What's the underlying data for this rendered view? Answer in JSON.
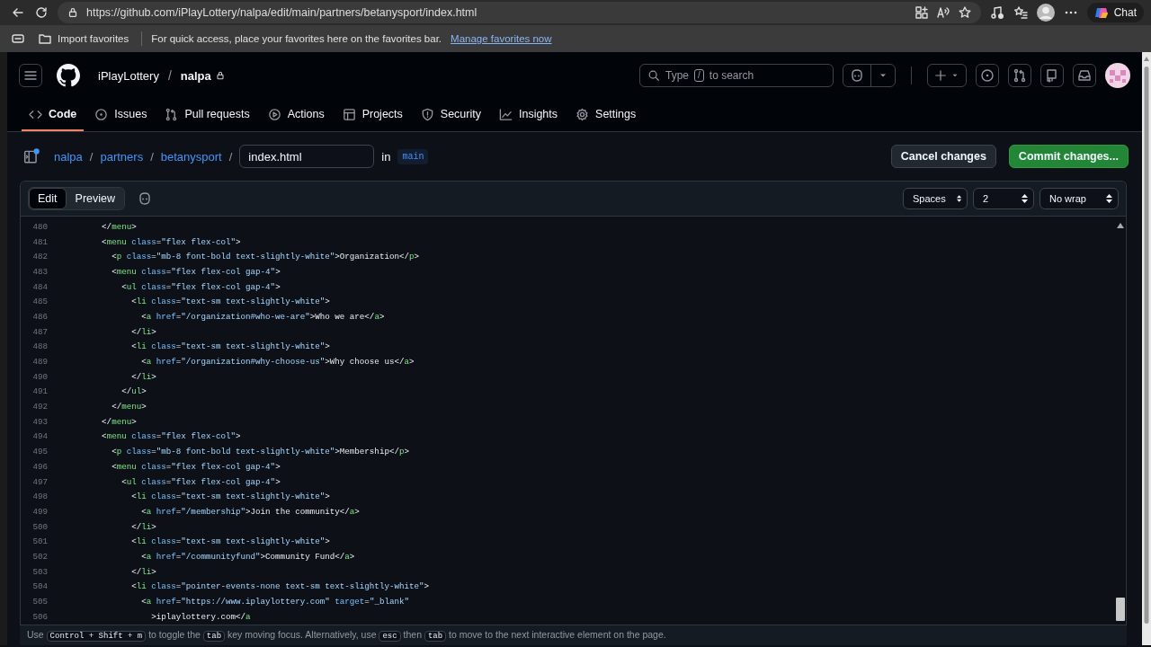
{
  "browser": {
    "url": "https://github.com/iPlayLottery/nalpa/edit/main/partners/betanysport/index.html",
    "import_favorites": "Import favorites",
    "favorites_message": "For quick access, place your favorites here on the favorites bar.",
    "favorites_link": "Manage favorites now",
    "chat": "Chat"
  },
  "header": {
    "owner": "iPlayLottery",
    "separator": "/",
    "repo": "nalpa",
    "search": {
      "before": "Type",
      "key": "/",
      "after": "to search"
    }
  },
  "nav_tabs": [
    {
      "label": "Code",
      "selected": true
    },
    {
      "label": "Issues",
      "selected": false
    },
    {
      "label": "Pull requests",
      "selected": false
    },
    {
      "label": "Actions",
      "selected": false
    },
    {
      "label": "Projects",
      "selected": false
    },
    {
      "label": "Security",
      "selected": false
    },
    {
      "label": "Insights",
      "selected": false
    },
    {
      "label": "Settings",
      "selected": false
    }
  ],
  "file_bar": {
    "breadcrumb": [
      "nalpa",
      "partners",
      "betanysport"
    ],
    "separator": "/",
    "filename": "index.html",
    "in_label": "in",
    "branch": "main",
    "cancel": "Cancel changes",
    "commit": "Commit changes..."
  },
  "editor": {
    "tabs": [
      {
        "label": "Edit",
        "selected": true
      },
      {
        "label": "Preview",
        "selected": false
      }
    ],
    "selects": [
      "Spaces",
      "2",
      "No wrap"
    ],
    "lines": [
      {
        "n": "480",
        "code": "        </menu>"
      },
      {
        "n": "481",
        "code": "        <menu class=\"flex flex-col\">"
      },
      {
        "n": "482",
        "code": "          <p class=\"mb-8 font-bold text-slightly-white\">Organization</p>"
      },
      {
        "n": "483",
        "code": "          <menu class=\"flex flex-col gap-4\">"
      },
      {
        "n": "484",
        "code": "            <ul class=\"flex flex-col gap-4\">"
      },
      {
        "n": "485",
        "code": "              <li class=\"text-sm text-slightly-white\">"
      },
      {
        "n": "486",
        "code": "                <a href=\"/organization#who-we-are\">Who we are</a>"
      },
      {
        "n": "487",
        "code": "              </li>"
      },
      {
        "n": "488",
        "code": "              <li class=\"text-sm text-slightly-white\">"
      },
      {
        "n": "489",
        "code": "                <a href=\"/organization#why-choose-us\">Why choose us</a>"
      },
      {
        "n": "490",
        "code": "              </li>"
      },
      {
        "n": "491",
        "code": "            </ul>"
      },
      {
        "n": "492",
        "code": "          </menu>"
      },
      {
        "n": "493",
        "code": "        </menu>"
      },
      {
        "n": "494",
        "code": "        <menu class=\"flex flex-col\">"
      },
      {
        "n": "495",
        "code": "          <p class=\"mb-8 font-bold text-slightly-white\">Membership</p>"
      },
      {
        "n": "496",
        "code": "          <menu class=\"flex flex-col gap-4\">"
      },
      {
        "n": "497",
        "code": "            <ul class=\"flex flex-col gap-4\">"
      },
      {
        "n": "498",
        "code": "              <li class=\"text-sm text-slightly-white\">"
      },
      {
        "n": "499",
        "code": "                <a href=\"/membership\">Join the community</a>"
      },
      {
        "n": "500",
        "code": "              </li>"
      },
      {
        "n": "501",
        "code": "              <li class=\"text-sm text-slightly-white\">"
      },
      {
        "n": "502",
        "code": "                <a href=\"/communityfund\">Community Fund</a>"
      },
      {
        "n": "503",
        "code": "              </li>"
      },
      {
        "n": "504",
        "code": "              <li class=\"pointer-events-none text-sm text-slightly-white\">"
      },
      {
        "n": "505",
        "code": "                <a href=\"https://www.iplaylottery.com\" target=\"_blank\""
      },
      {
        "n": "506",
        "code": "                  >iplaylottery.com</a"
      }
    ]
  },
  "hint": [
    {
      "kind": "text",
      "text": "Use"
    },
    {
      "kind": "key",
      "text": "Control + Shift + m"
    },
    {
      "kind": "text",
      "text": "to toggle the"
    },
    {
      "kind": "key",
      "text": "tab"
    },
    {
      "kind": "text",
      "text": "key moving focus. Alternatively, use"
    },
    {
      "kind": "key",
      "text": "esc"
    },
    {
      "kind": "text",
      "text": "then"
    },
    {
      "kind": "key",
      "text": "tab"
    },
    {
      "kind": "text",
      "text": "to move to the next interactive element on the page."
    }
  ]
}
